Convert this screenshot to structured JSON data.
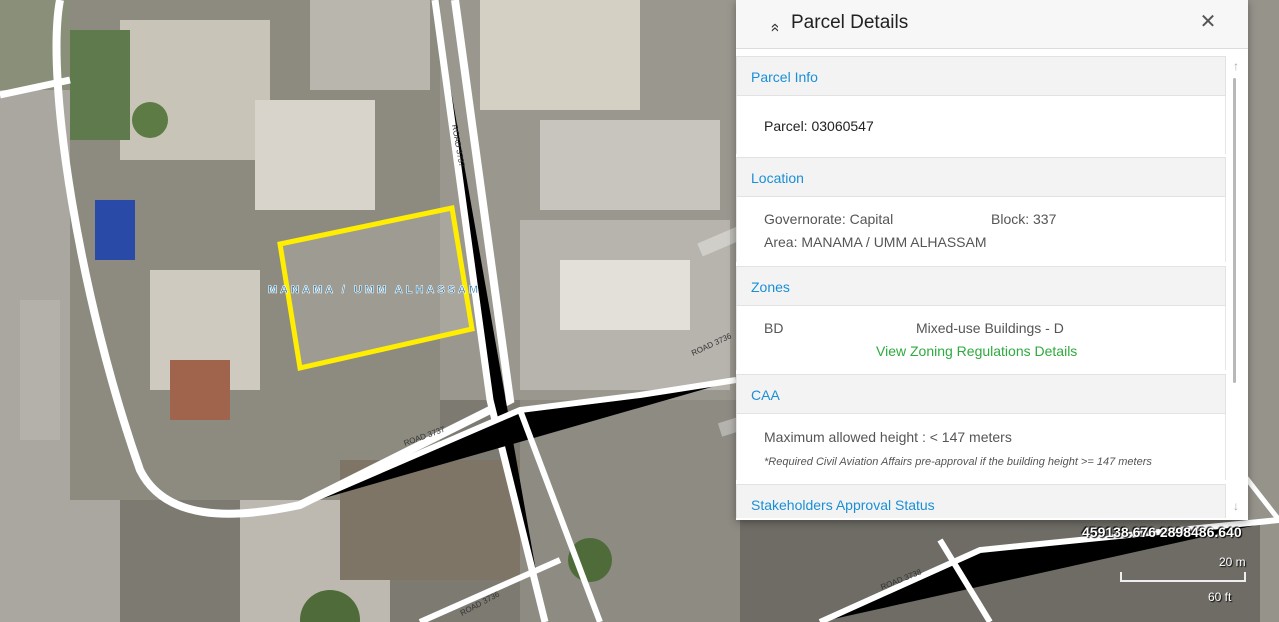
{
  "panel": {
    "title": "Parcel Details",
    "close_symbol": "✕",
    "collapse_symbol": "»"
  },
  "parcel_info": {
    "header": "Parcel Info",
    "parcel": "Parcel: 03060547"
  },
  "location": {
    "header": "Location",
    "governorate": "Governorate: Capital",
    "block": "Block: 337",
    "area": "Area: MANAMA / UMM ALHASSAM"
  },
  "zones": {
    "header": "Zones",
    "code": "BD",
    "description": "Mixed-use Buildings - D",
    "link": "View Zoning Regulations Details"
  },
  "caa": {
    "header": "CAA",
    "max_height": "Maximum allowed height : < 147 meters",
    "note": "*Required Civil Aviation Affairs pre-approval if the building height >= 147 meters"
  },
  "stakeholders": {
    "header": "Stakeholders Approval Status"
  },
  "map": {
    "area_label": "MANAMA / UMM ALHASSAM",
    "road_labels": [
      "ROAD 3737",
      "ROAD 3737",
      "ROAD 3736",
      "ROAD 3736",
      "ROAD 3738"
    ],
    "coordinates": "459138.676 2898486.640",
    "scale_metric": "20 m",
    "scale_imperial": "60 ft",
    "parcel_color": "#ffee00",
    "road_color": "#ffffff",
    "accent_color": "#1a8fd6",
    "link_color": "#2eaa3e"
  }
}
